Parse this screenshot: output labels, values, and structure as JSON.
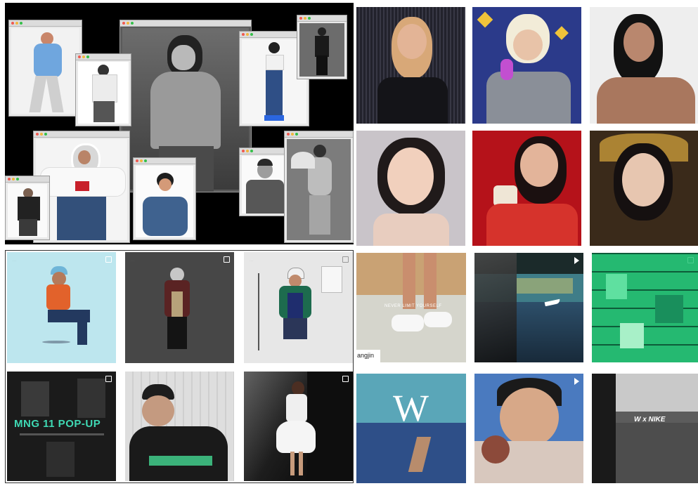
{
  "colors": {
    "collage_bg": "#000000",
    "window_chrome": "#dcdcdc",
    "mng_green": "#3fd9b4",
    "nike_green": "#29c77a"
  },
  "icons": {
    "instagram_multi": "square-stack-icon",
    "instagram_video": "play-icon",
    "window_controls": "traffic-light-dots"
  },
  "overlays": {
    "mng_popup_title": "MNG 11 POP-UP",
    "nike_slogan": "NEVER LIMIT YOURSELF",
    "nike_brand_partial": "angjin",
    "w_mark_a": "W",
    "w_mark_b": "W",
    "w_x_nike": "W x NIKE"
  }
}
